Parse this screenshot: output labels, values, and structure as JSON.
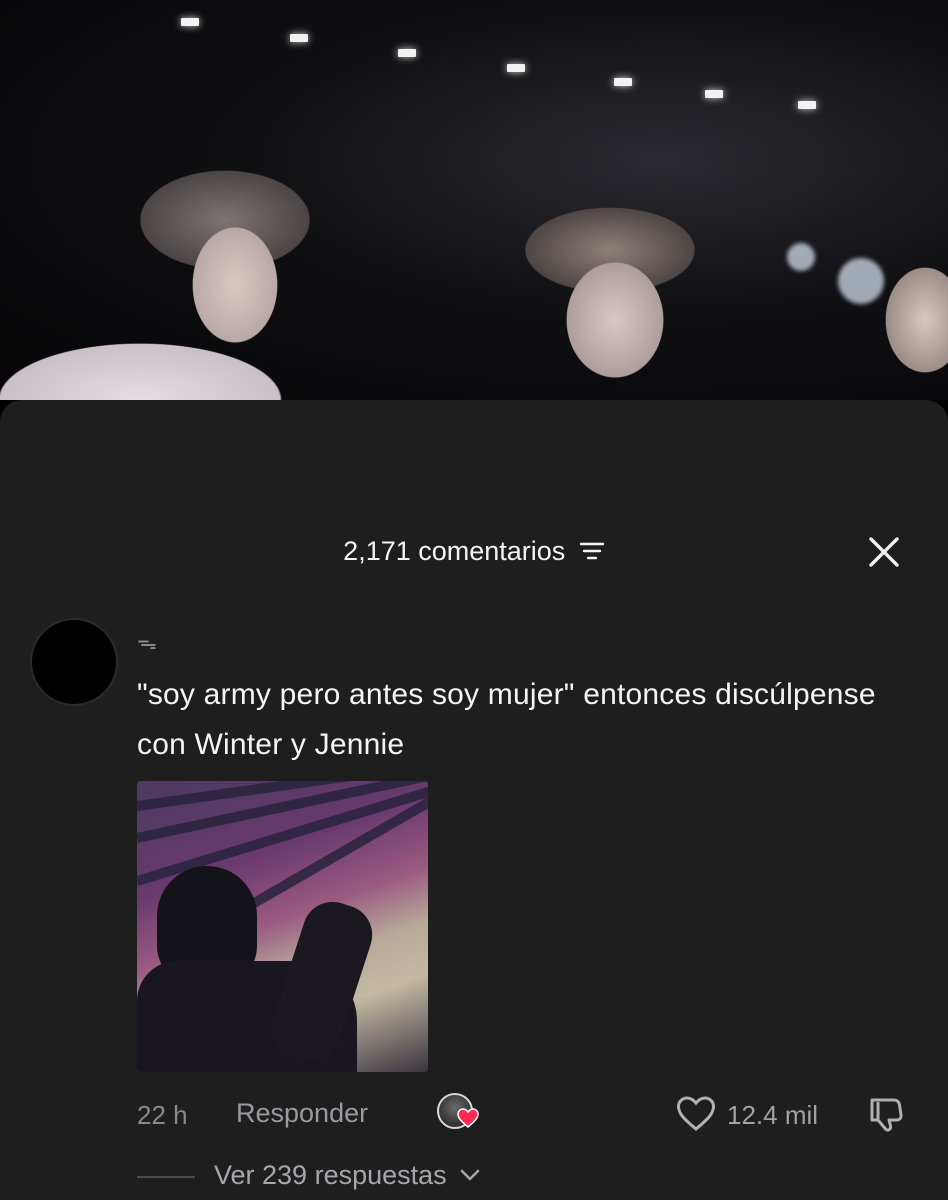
{
  "video": {
    "background_color": "#0c0c0e"
  },
  "comments": {
    "header": {
      "count_label": "2,171 comentarios",
      "filter_icon": "sort-lines-icon",
      "close_icon": "close-x-icon"
    },
    "comment": {
      "username": "ᯓ",
      "text": "\"soy army pero antes soy mujer\" entonces discúlpense con Winter y Jennie",
      "timestamp": "22 h",
      "reply_label": "Responder",
      "like_count": "12.4 mil",
      "view_replies_label": "Ver 239 respuestas"
    },
    "colors": {
      "sheet_background": "#1e1e1f",
      "text_primary": "#f5f5f5",
      "text_secondary": "#8a8a8c",
      "creator_heart": "#fe2c55"
    }
  }
}
